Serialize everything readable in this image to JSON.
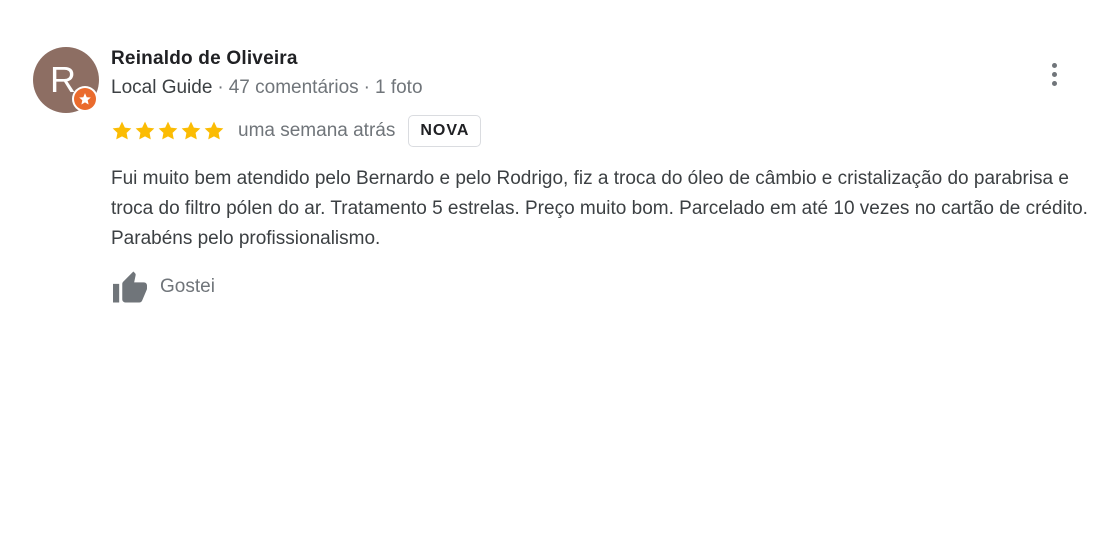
{
  "review": {
    "avatar_letter": "R",
    "author_name": "Reinaldo de Oliveira",
    "author_level": "Local Guide",
    "separator": "·",
    "review_count": "47 comentários",
    "photo_count": "1 foto",
    "rating": 5,
    "rating_max": 5,
    "date": "uma semana atrás",
    "badge": "NOVA",
    "text": "Fui muito bem atendido pelo Bernardo e pelo Rodrigo, fiz a troca do óleo de câmbio e cristalização do parabrisa e troca do filtro pólen do ar. Tratamento 5 estrelas. Preço muito bom. Parcelado em até 10 vezes no cartão de crédito. Parabéns pelo profissionalismo.",
    "like_label": "Gostei"
  },
  "colors": {
    "avatar": "#8d6e63",
    "guide_badge": "#ea6b2d",
    "star": "#fbbc04",
    "muted_text": "#70757a",
    "body_text": "#3c4043"
  },
  "icons": {
    "more": "more-vert-icon",
    "guide": "local-guide-star-icon",
    "star": "star-icon",
    "like": "thumb-up-icon"
  }
}
